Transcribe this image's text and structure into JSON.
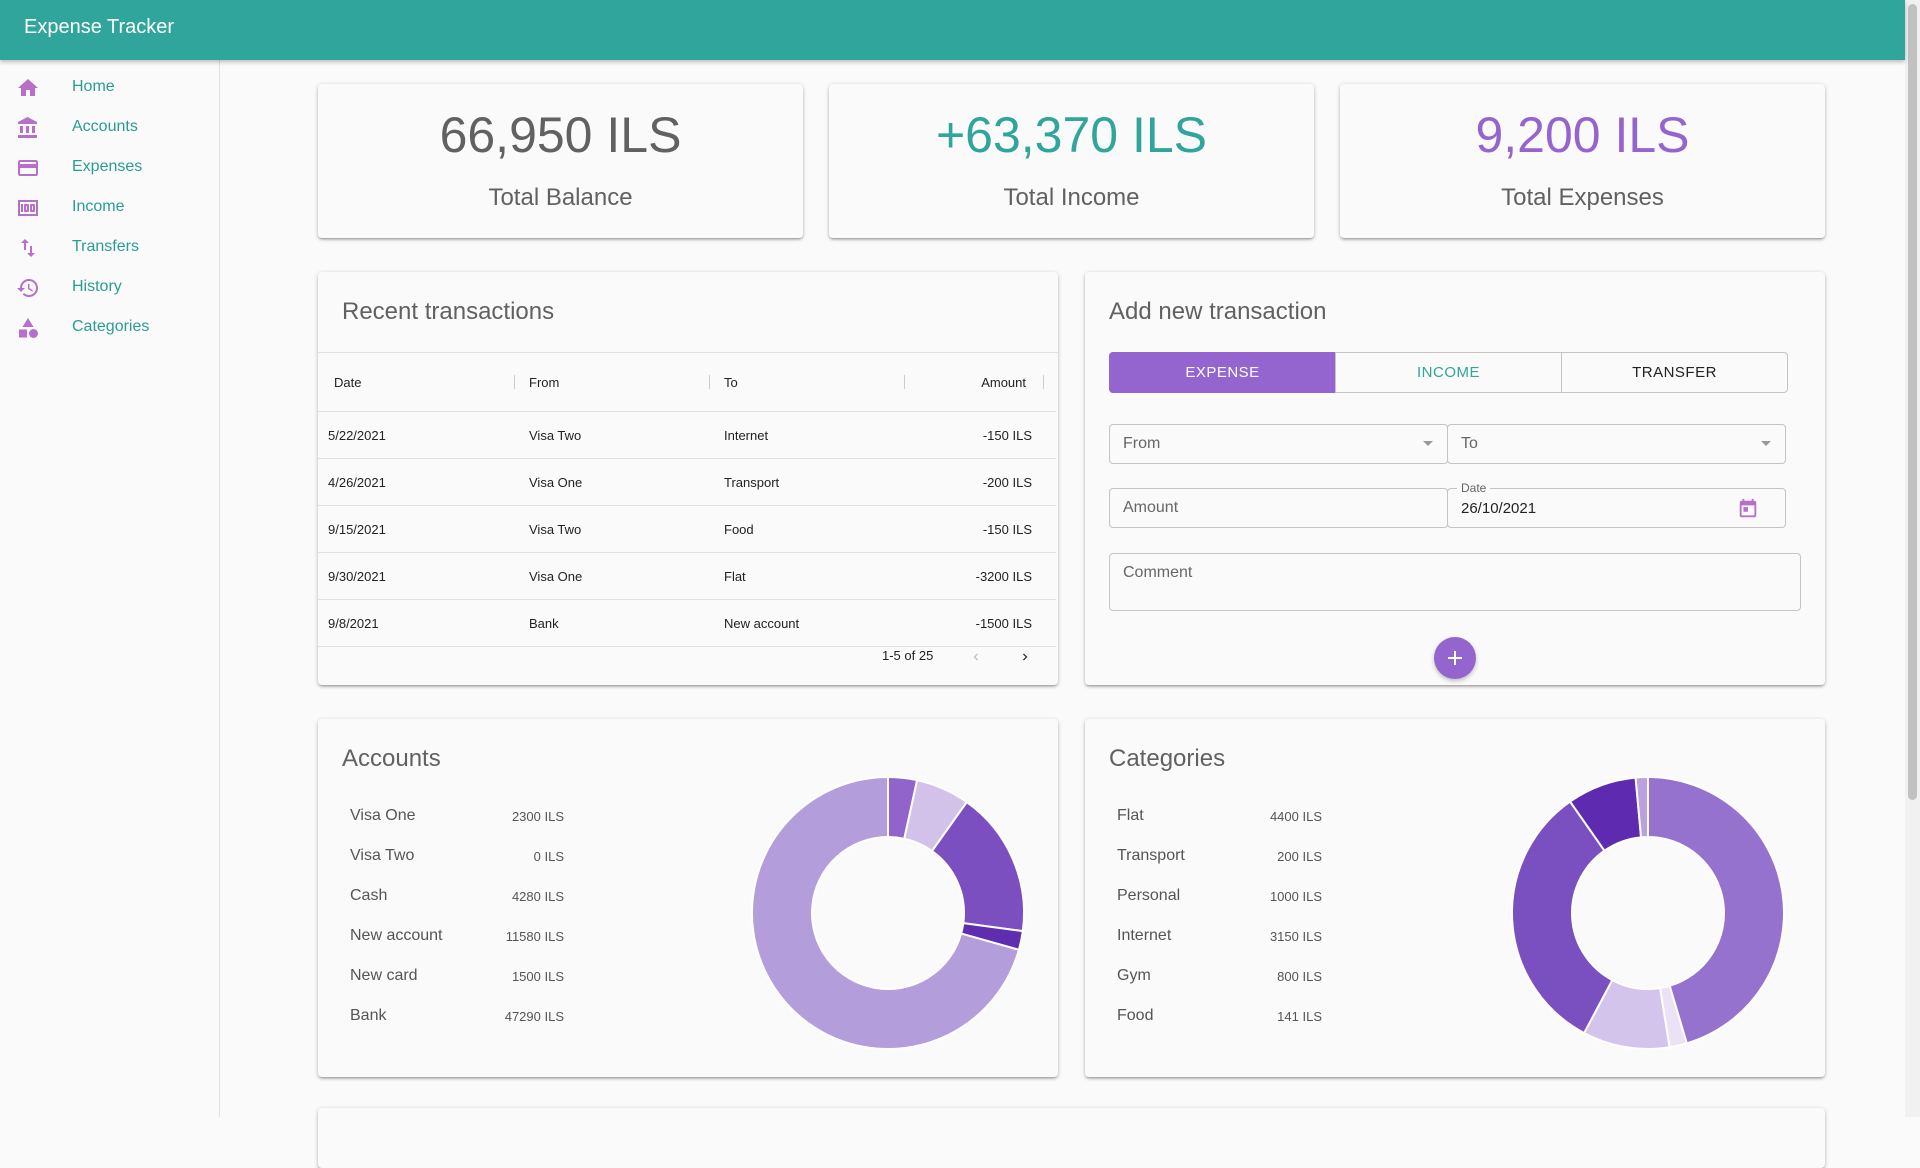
{
  "app": {
    "title": "Expense Tracker"
  },
  "sidebar": {
    "items": [
      {
        "label": "Home",
        "icon": "home-icon"
      },
      {
        "label": "Accounts",
        "icon": "bank-icon"
      },
      {
        "label": "Expenses",
        "icon": "credit-card-icon"
      },
      {
        "label": "Income",
        "icon": "money-icon"
      },
      {
        "label": "Transfers",
        "icon": "swap-icon"
      },
      {
        "label": "History",
        "icon": "history-icon"
      },
      {
        "label": "Categories",
        "icon": "shapes-icon"
      }
    ]
  },
  "stats": {
    "balance": {
      "value": "66,950 ILS",
      "label": "Total Balance"
    },
    "income": {
      "value": "+63,370 ILS",
      "label": "Total Income"
    },
    "expenses": {
      "value": "9,200 ILS",
      "label": "Total Expenses"
    }
  },
  "transactions": {
    "title": "Recent transactions",
    "headers": {
      "date": "Date",
      "from": "From",
      "to": "To",
      "amount": "Amount"
    },
    "rows": [
      {
        "date": "5/22/2021",
        "from": "Visa Two",
        "to": "Internet",
        "amount": "-150 ILS"
      },
      {
        "date": "4/26/2021",
        "from": "Visa One",
        "to": "Transport",
        "amount": "-200 ILS"
      },
      {
        "date": "9/15/2021",
        "from": "Visa Two",
        "to": "Food",
        "amount": "-150 ILS"
      },
      {
        "date": "9/30/2021",
        "from": "Visa One",
        "to": "Flat",
        "amount": "-3200 ILS"
      },
      {
        "date": "9/8/2021",
        "from": "Bank",
        "to": "New account",
        "amount": "-1500 ILS"
      }
    ],
    "pagination": "1-5 of 25"
  },
  "add_form": {
    "title": "Add new transaction",
    "tabs": {
      "expense": "EXPENSE",
      "income": "INCOME",
      "transfer": "TRANSFER"
    },
    "from_placeholder": "From",
    "to_placeholder": "To",
    "amount_placeholder": "Amount",
    "date_label": "Date",
    "date_value": "26/10/2021",
    "comment_placeholder": "Comment"
  },
  "accounts": {
    "title": "Accounts",
    "items": [
      {
        "name": "Visa One",
        "amount": "2300 ILS"
      },
      {
        "name": "Visa Two",
        "amount": "0 ILS"
      },
      {
        "name": "Cash",
        "amount": "4280 ILS"
      },
      {
        "name": "New account",
        "amount": "11580 ILS"
      },
      {
        "name": "New card",
        "amount": "1500 ILS"
      },
      {
        "name": "Bank",
        "amount": "47290 ILS"
      }
    ]
  },
  "categories": {
    "title": "Categories",
    "items": [
      {
        "name": "Flat",
        "amount": "4400 ILS"
      },
      {
        "name": "Transport",
        "amount": "200 ILS"
      },
      {
        "name": "Personal",
        "amount": "1000 ILS"
      },
      {
        "name": "Internet",
        "amount": "3150 ILS"
      },
      {
        "name": "Gym",
        "amount": "800 ILS"
      },
      {
        "name": "Food",
        "amount": "141 ILS"
      }
    ]
  },
  "colors": {
    "primary": "#2fa59b",
    "accent": "#9565cf",
    "balance": "#616161",
    "income": "#2fa59b",
    "expenses": "#9565cf"
  },
  "chart_data": [
    {
      "type": "pie",
      "categories": [
        "Visa One",
        "Visa Two",
        "Cash",
        "New account",
        "New card",
        "Bank"
      ],
      "values": [
        2300,
        0,
        4280,
        11580,
        1500,
        47290
      ],
      "colors": [
        "#9064cb",
        "#d9c8ee",
        "#d2c2ea",
        "#7c4fc1",
        "#5e2db0",
        "#b39ddb"
      ]
    },
    {
      "type": "pie",
      "categories": [
        "Flat",
        "Transport",
        "Personal",
        "Internet",
        "Gym",
        "Food"
      ],
      "values": [
        4400,
        200,
        1000,
        3150,
        800,
        141
      ],
      "colors": [
        "#9672cf",
        "#ebe2f6",
        "#d2c4ea",
        "#7a4fc0",
        "#5d2ab0",
        "#b9a2de"
      ]
    }
  ]
}
